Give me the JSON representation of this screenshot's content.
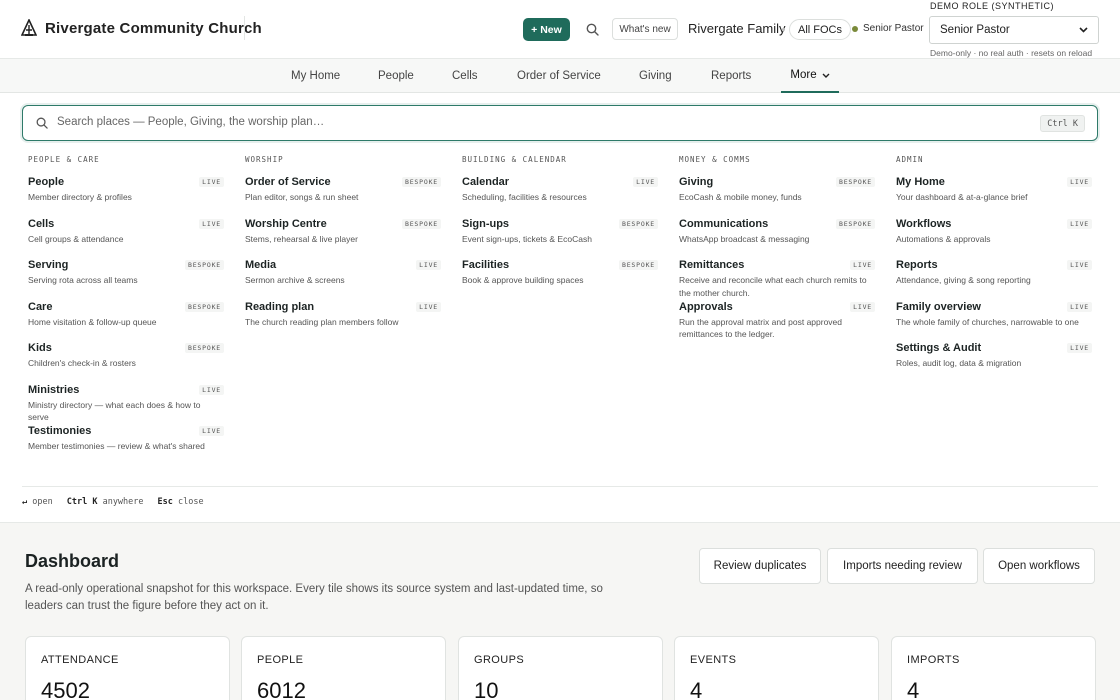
{
  "header": {
    "brand": "Rivergate Community Church",
    "new_label": "+ New",
    "whats_new": "What's new",
    "family_name": "Rivergate Family",
    "all_focs": "All FOCs",
    "current_role": "Senior Pastor",
    "demo_role_label": "DEMO ROLE (SYNTHETIC)",
    "role_select_value": "Senior Pastor",
    "demo_note": "Demo-only · no real auth · resets on reload",
    "accent_color": "#1f6b5b"
  },
  "nav": {
    "items": [
      "My Home",
      "People",
      "Cells",
      "Order of Service",
      "Giving",
      "Reports",
      "More"
    ],
    "active": "More"
  },
  "palette": {
    "search_placeholder": "Search places — People, Giving, the worship plan…",
    "shortcut": "Ctrl K",
    "columns": [
      {
        "heading": "PEOPLE & CARE",
        "entries": [
          {
            "title": "People",
            "desc": "Member directory & profiles",
            "tag": "LIVE"
          },
          {
            "title": "Cells",
            "desc": "Cell groups & attendance",
            "tag": "LIVE"
          },
          {
            "title": "Serving",
            "desc": "Serving rota across all teams",
            "tag": "BESPOKE"
          },
          {
            "title": "Care",
            "desc": "Home visitation & follow-up queue",
            "tag": "BESPOKE"
          },
          {
            "title": "Kids",
            "desc": "Children's check-in & rosters",
            "tag": "BESPOKE"
          },
          {
            "title": "Ministries",
            "desc": "Ministry directory — what each does & how to serve",
            "tag": "LIVE"
          },
          {
            "title": "Testimonies",
            "desc": "Member testimonies — review & what's shared",
            "tag": "LIVE"
          }
        ]
      },
      {
        "heading": "WORSHIP",
        "entries": [
          {
            "title": "Order of Service",
            "desc": "Plan editor, songs & run sheet",
            "tag": "BESPOKE"
          },
          {
            "title": "Worship Centre",
            "desc": "Stems, rehearsal & live player",
            "tag": "BESPOKE"
          },
          {
            "title": "Media",
            "desc": "Sermon archive & screens",
            "tag": "LIVE"
          },
          {
            "title": "Reading plan",
            "desc": "The church reading plan members follow",
            "tag": "LIVE"
          }
        ]
      },
      {
        "heading": "BUILDING & CALENDAR",
        "entries": [
          {
            "title": "Calendar",
            "desc": "Scheduling, facilities & resources",
            "tag": "LIVE"
          },
          {
            "title": "Sign-ups",
            "desc": "Event sign-ups, tickets & EcoCash",
            "tag": "BESPOKE"
          },
          {
            "title": "Facilities",
            "desc": "Book & approve building spaces",
            "tag": "BESPOKE"
          }
        ]
      },
      {
        "heading": "MONEY & COMMS",
        "entries": [
          {
            "title": "Giving",
            "desc": "EcoCash & mobile money, funds",
            "tag": "BESPOKE"
          },
          {
            "title": "Communications",
            "desc": "WhatsApp broadcast & messaging",
            "tag": "BESPOKE"
          },
          {
            "title": "Remittances",
            "desc": "Receive and reconcile what each church remits to the mother church.",
            "tag": "LIVE"
          },
          {
            "title": "Approvals",
            "desc": "Run the approval matrix and post approved remittances to the ledger.",
            "tag": "LIVE"
          }
        ]
      },
      {
        "heading": "ADMIN",
        "entries": [
          {
            "title": "My Home",
            "desc": "Your dashboard & at-a-glance brief",
            "tag": "LIVE"
          },
          {
            "title": "Workflows",
            "desc": "Automations & approvals",
            "tag": "LIVE"
          },
          {
            "title": "Reports",
            "desc": "Attendance, giving & song reporting",
            "tag": "LIVE"
          },
          {
            "title": "Family overview",
            "desc": "The whole family of churches, narrowable to one",
            "tag": "LIVE"
          },
          {
            "title": "Settings & Audit",
            "desc": "Roles, audit log, data & migration",
            "tag": "LIVE"
          }
        ]
      }
    ],
    "footer": [
      {
        "key": "↵",
        "label": "open"
      },
      {
        "key": "Ctrl K",
        "label": "anywhere"
      },
      {
        "key": "Esc",
        "label": "close"
      }
    ]
  },
  "dashboard": {
    "title": "Dashboard",
    "description": "A read-only operational snapshot for this workspace. Every tile shows its source system and last-updated time, so leaders can trust the figure before they act on it.",
    "buttons": [
      "Review duplicates",
      "Imports needing review",
      "Open workflows"
    ],
    "tiles": [
      {
        "label": "ATTENDANCE",
        "value": "4502"
      },
      {
        "label": "PEOPLE",
        "value": "6012"
      },
      {
        "label": "GROUPS",
        "value": "10"
      },
      {
        "label": "EVENTS",
        "value": "4"
      },
      {
        "label": "IMPORTS",
        "value": "4"
      }
    ]
  }
}
